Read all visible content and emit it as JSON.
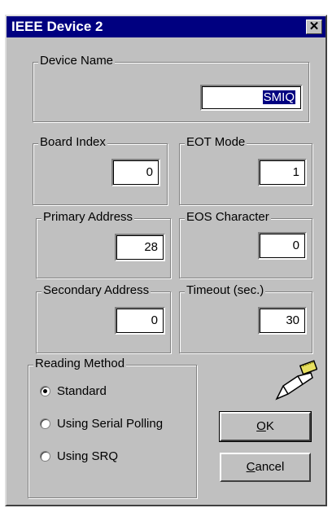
{
  "window": {
    "title": "IEEE Device 2",
    "close_glyph": "✕"
  },
  "device_name": {
    "label": "Device Name",
    "value": "SMIQ"
  },
  "board_index": {
    "label": "Board Index",
    "value": "0"
  },
  "eot_mode": {
    "label": "EOT Mode",
    "value": "1"
  },
  "primary_address": {
    "label": "Primary Address",
    "value": "28"
  },
  "eos_character": {
    "label": "EOS Character",
    "value": "0"
  },
  "secondary_address": {
    "label": "Secondary Address",
    "value": "0"
  },
  "timeout": {
    "label": "Timeout (sec.)",
    "value": "30"
  },
  "reading_method": {
    "label": "Reading Method",
    "options": [
      {
        "label": "Standard",
        "selected": true
      },
      {
        "label": "Using Serial Polling",
        "selected": false
      },
      {
        "label": "Using SRQ",
        "selected": false
      }
    ]
  },
  "buttons": {
    "ok": {
      "mnemonic": "O",
      "rest": "K"
    },
    "cancel": {
      "mnemonic": "C",
      "rest": "ancel"
    }
  },
  "icons": {
    "connector": "gpib-connector-icon"
  }
}
